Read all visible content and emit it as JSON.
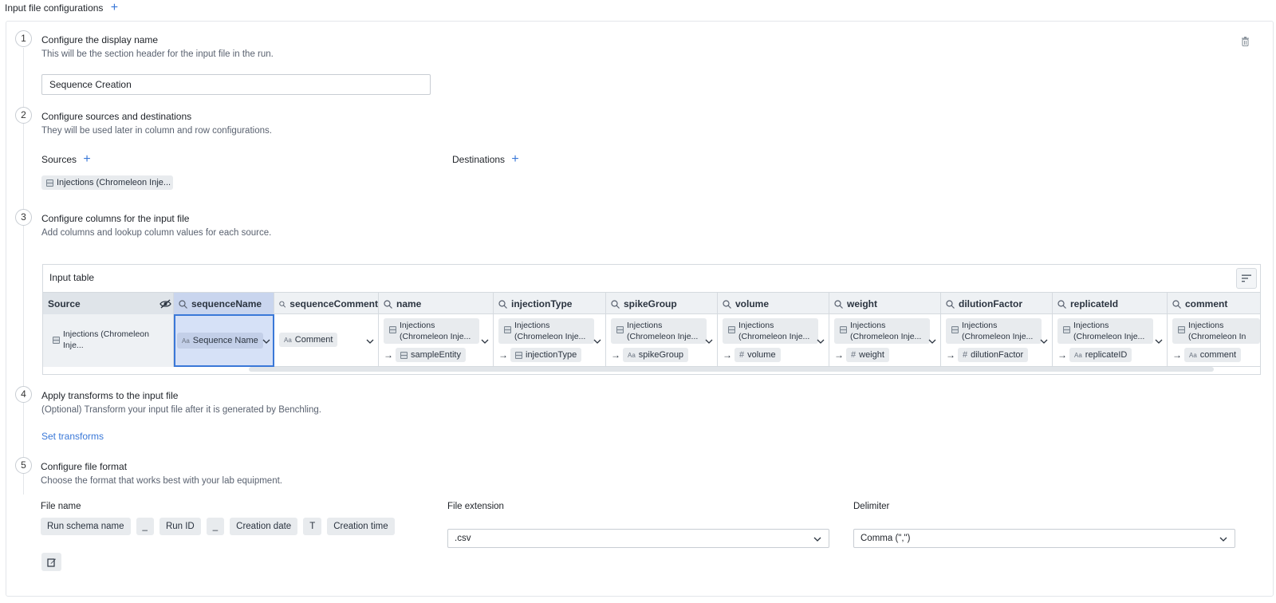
{
  "header": {
    "title": "Input file configurations"
  },
  "steps": [
    {
      "number": "1",
      "title": "Configure the display name",
      "subtitle": "This will be the section header for the input file in the run."
    },
    {
      "number": "2",
      "title": "Configure sources and destinations",
      "subtitle": "They will be used later in column and row configurations."
    },
    {
      "number": "3",
      "title": "Configure columns for the input file",
      "subtitle": "Add columns and lookup column values for each source."
    },
    {
      "number": "4",
      "title": "Apply transforms to the input file",
      "subtitle": "(Optional) Transform your input file after it is generated by Benchling."
    },
    {
      "number": "5",
      "title": "Configure file format",
      "subtitle": "Choose the format that works best with your lab equipment."
    }
  ],
  "display_name": {
    "value": "Sequence Creation"
  },
  "sources": {
    "label": "Sources",
    "items": [
      "Injections (Chromeleon Inje..."
    ]
  },
  "destinations": {
    "label": "Destinations"
  },
  "input_table": {
    "title": "Input table",
    "source_header": "Source",
    "source_cell": "Injections (Chromeleon Inje...",
    "columns": [
      {
        "name": "sequenceName",
        "top": "Sequence Name",
        "top_type": "text"
      },
      {
        "name": "sequenceComment",
        "top": "Comment",
        "top_type": "text"
      },
      {
        "name": "name",
        "source": "Injections (Chromeleon Inje...",
        "target": "sampleEntity",
        "target_type": "table"
      },
      {
        "name": "injectionType",
        "source": "Injections (Chromeleon Inje...",
        "target": "injectionType",
        "target_type": "table"
      },
      {
        "name": "spikeGroup",
        "source": "Injections (Chromeleon Inje...",
        "target": "spikeGroup",
        "target_type": "text"
      },
      {
        "name": "volume",
        "source": "Injections (Chromeleon Inje...",
        "target": "volume",
        "target_type": "number"
      },
      {
        "name": "weight",
        "source": "Injections (Chromeleon Inje...",
        "target": "weight",
        "target_type": "number"
      },
      {
        "name": "dilutionFactor",
        "source": "Injections (Chromeleon Inje...",
        "target": "dilutionFactor",
        "target_type": "number"
      },
      {
        "name": "replicateId",
        "source": "Injections (Chromeleon Inje...",
        "target": "replicateID",
        "target_type": "text"
      },
      {
        "name": "comment",
        "source": "Injections (Chromeleon In",
        "target": "comment",
        "target_type": "text"
      }
    ]
  },
  "transforms": {
    "link": "Set transforms"
  },
  "file_format": {
    "file_name_label": "File name",
    "file_name_parts": [
      "Run schema name",
      "_",
      "Run ID",
      "_",
      "Creation date",
      "T",
      "Creation time"
    ],
    "extension_label": "File extension",
    "extension_value": ".csv",
    "delimiter_label": "Delimiter",
    "delimiter_value": "Comma (\",\")"
  },
  "icons": {
    "plus": "plus-icon",
    "trash": "trash-icon",
    "search": "search-icon",
    "table": "table-icon",
    "text_type": "text-type-icon",
    "number_type": "hash-icon",
    "chevron": "chevron-down-icon",
    "sort": "sort-icon",
    "hide": "eye-off-icon",
    "edit": "edit-icon"
  },
  "colors": {
    "accent": "#3a78d8",
    "selected_cell": "#d6e1f7",
    "header_bg": "#eef1f4"
  }
}
